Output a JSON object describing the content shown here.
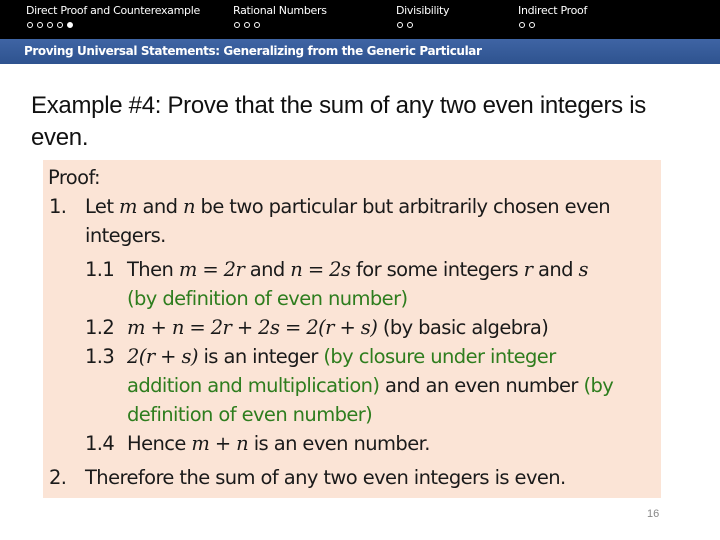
{
  "nav": {
    "sections": [
      {
        "label": "Direct Proof and Counterexample",
        "dots": 5,
        "active_dot": 4
      },
      {
        "label": "Rational Numbers",
        "dots": 3,
        "active_dot": null
      },
      {
        "label": "Divisibility",
        "dots": 2,
        "active_dot": null
      },
      {
        "label": "Indirect Proof",
        "dots": 2,
        "active_dot": null
      }
    ]
  },
  "subtitle": "Proving Universal Statements: Generalizing from the Generic Particular",
  "title": "Example #4: Prove that the sum of any two even integers is even.",
  "proof": {
    "heading": "Proof:",
    "lines": [
      {
        "num": "1.",
        "parts": [
          [
            "t",
            "Let "
          ],
          [
            "m",
            "m"
          ],
          [
            "t",
            " and "
          ],
          [
            "m",
            "n"
          ],
          [
            "t",
            " be two particular but arbitrarily chosen even"
          ]
        ]
      },
      {
        "num": "",
        "parts": [
          [
            "t",
            "integers."
          ]
        ]
      },
      {
        "num": "1.1",
        "parts": [
          [
            "t",
            "Then "
          ],
          [
            "m",
            "m = 2r"
          ],
          [
            "t",
            " and "
          ],
          [
            "m",
            "n = 2s"
          ],
          [
            "t",
            " for some integers "
          ],
          [
            "m",
            "r"
          ],
          [
            "t",
            " and "
          ],
          [
            "m",
            "s"
          ]
        ]
      },
      {
        "num": "",
        "parts": [
          [
            "g",
            "(by definition of even number)"
          ]
        ]
      },
      {
        "num": "1.2",
        "parts": [
          [
            "m",
            "m + n = 2r + 2s = 2(r + s)"
          ],
          [
            "t",
            " (by basic algebra)"
          ]
        ]
      },
      {
        "num": "1.3",
        "parts": [
          [
            "m",
            "2(r + s)"
          ],
          [
            "t",
            " is an integer "
          ],
          [
            "g",
            "(by closure under integer"
          ]
        ]
      },
      {
        "num": "",
        "parts": [
          [
            "g",
            "addition and multiplication)"
          ],
          [
            "t",
            " and an even number "
          ],
          [
            "g",
            "(by"
          ]
        ]
      },
      {
        "num": "",
        "parts": [
          [
            "g",
            "definition of even number)"
          ]
        ]
      },
      {
        "num": "1.4",
        "parts": [
          [
            "t",
            "Hence "
          ],
          [
            "m",
            "m + n"
          ],
          [
            "t",
            " is an even number."
          ]
        ]
      },
      {
        "num": "2.",
        "parts": [
          [
            "t",
            "Therefore the sum of any two even integers is even."
          ]
        ]
      }
    ]
  },
  "page_number": "16",
  "colors": {
    "top_bar": "#000000",
    "sub_bar": "#345a97",
    "proof_bg": "#fbe4d6",
    "justification_green": "#2e7d1e"
  }
}
